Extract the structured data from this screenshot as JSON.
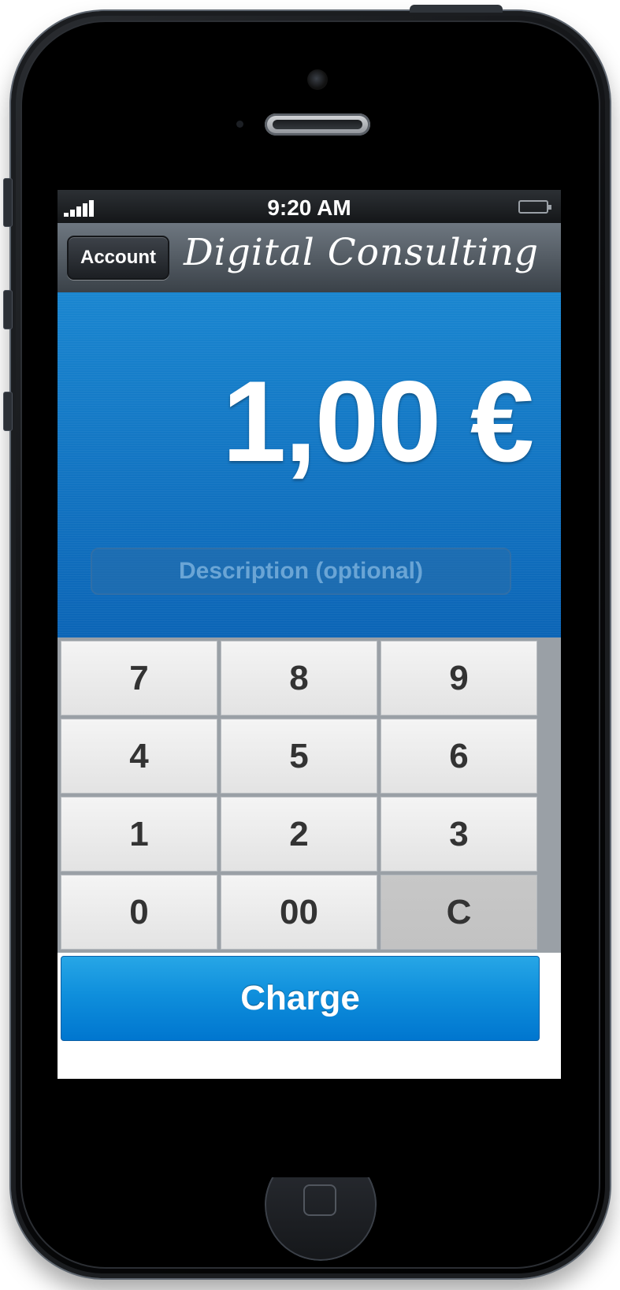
{
  "status_bar": {
    "time": "9:20 AM"
  },
  "nav": {
    "account_label": "Account",
    "brand": "Digital Consulting"
  },
  "amount": {
    "display": "1,00 €"
  },
  "description": {
    "placeholder": "Description (optional)",
    "value": ""
  },
  "keypad": {
    "keys": [
      "7",
      "8",
      "9",
      "4",
      "5",
      "6",
      "1",
      "2",
      "3",
      "0",
      "00",
      "C"
    ]
  },
  "charge": {
    "label": "Charge"
  },
  "colors": {
    "accent": "#0f8fdc",
    "amount_bg": "#1a86d0",
    "key_bg": "#e9e9e9"
  },
  "icons": [
    "signal-icon",
    "battery-icon",
    "camera-icon",
    "home-button-icon"
  ]
}
